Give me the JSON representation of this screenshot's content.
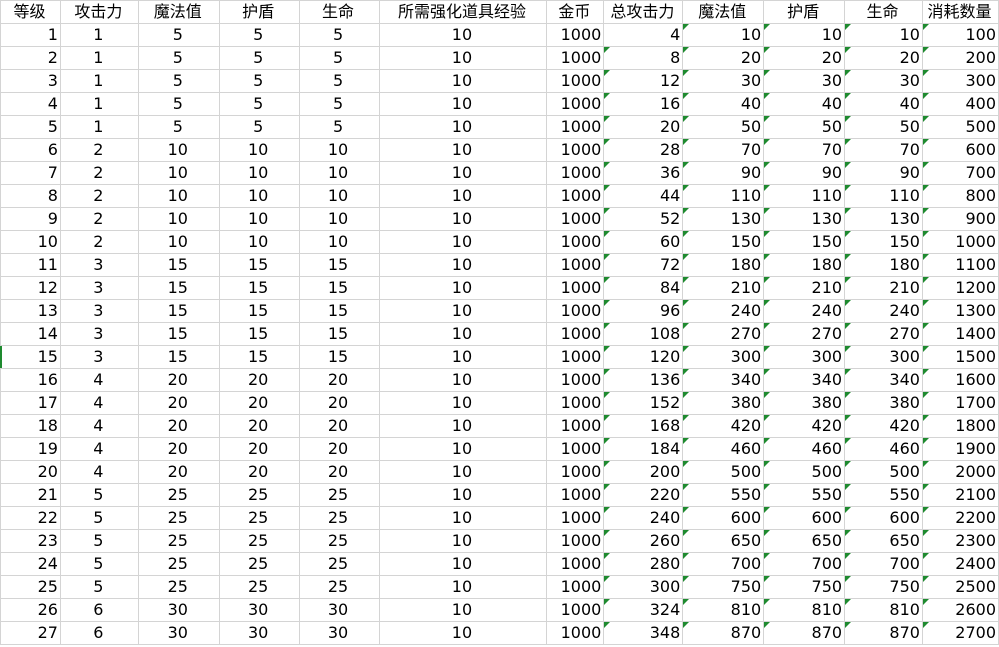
{
  "sheet": {
    "headers": [
      "等级",
      "攻击力",
      "魔法值",
      "护盾",
      "生命",
      "所需强化道具经验",
      "金币",
      "总攻击力",
      "魔法值",
      "护盾",
      "生命",
      "消耗数量"
    ],
    "rows": [
      [
        "1",
        "1",
        "5",
        "5",
        "5",
        "10",
        "1000",
        "4",
        "10",
        "10",
        "10",
        "100"
      ],
      [
        "2",
        "1",
        "5",
        "5",
        "5",
        "10",
        "1000",
        "8",
        "20",
        "20",
        "20",
        "200"
      ],
      [
        "3",
        "1",
        "5",
        "5",
        "5",
        "10",
        "1000",
        "12",
        "30",
        "30",
        "30",
        "300"
      ],
      [
        "4",
        "1",
        "5",
        "5",
        "5",
        "10",
        "1000",
        "16",
        "40",
        "40",
        "40",
        "400"
      ],
      [
        "5",
        "1",
        "5",
        "5",
        "5",
        "10",
        "1000",
        "20",
        "50",
        "50",
        "50",
        "500"
      ],
      [
        "6",
        "2",
        "10",
        "10",
        "10",
        "10",
        "1000",
        "28",
        "70",
        "70",
        "70",
        "600"
      ],
      [
        "7",
        "2",
        "10",
        "10",
        "10",
        "10",
        "1000",
        "36",
        "90",
        "90",
        "90",
        "700"
      ],
      [
        "8",
        "2",
        "10",
        "10",
        "10",
        "10",
        "1000",
        "44",
        "110",
        "110",
        "110",
        "800"
      ],
      [
        "9",
        "2",
        "10",
        "10",
        "10",
        "10",
        "1000",
        "52",
        "130",
        "130",
        "130",
        "900"
      ],
      [
        "10",
        "2",
        "10",
        "10",
        "10",
        "10",
        "1000",
        "60",
        "150",
        "150",
        "150",
        "1000"
      ],
      [
        "11",
        "3",
        "15",
        "15",
        "15",
        "10",
        "1000",
        "72",
        "180",
        "180",
        "180",
        "1100"
      ],
      [
        "12",
        "3",
        "15",
        "15",
        "15",
        "10",
        "1000",
        "84",
        "210",
        "210",
        "210",
        "1200"
      ],
      [
        "13",
        "3",
        "15",
        "15",
        "15",
        "10",
        "1000",
        "96",
        "240",
        "240",
        "240",
        "1300"
      ],
      [
        "14",
        "3",
        "15",
        "15",
        "15",
        "10",
        "1000",
        "108",
        "270",
        "270",
        "270",
        "1400"
      ],
      [
        "15",
        "3",
        "15",
        "15",
        "15",
        "10",
        "1000",
        "120",
        "300",
        "300",
        "300",
        "1500"
      ],
      [
        "16",
        "4",
        "20",
        "20",
        "20",
        "10",
        "1000",
        "136",
        "340",
        "340",
        "340",
        "1600"
      ],
      [
        "17",
        "4",
        "20",
        "20",
        "20",
        "10",
        "1000",
        "152",
        "380",
        "380",
        "380",
        "1700"
      ],
      [
        "18",
        "4",
        "20",
        "20",
        "20",
        "10",
        "1000",
        "168",
        "420",
        "420",
        "420",
        "1800"
      ],
      [
        "19",
        "4",
        "20",
        "20",
        "20",
        "10",
        "1000",
        "184",
        "460",
        "460",
        "460",
        "1900"
      ],
      [
        "20",
        "4",
        "20",
        "20",
        "20",
        "10",
        "1000",
        "200",
        "500",
        "500",
        "500",
        "2000"
      ],
      [
        "21",
        "5",
        "25",
        "25",
        "25",
        "10",
        "1000",
        "220",
        "550",
        "550",
        "550",
        "2100"
      ],
      [
        "22",
        "5",
        "25",
        "25",
        "25",
        "10",
        "1000",
        "240",
        "600",
        "600",
        "600",
        "2200"
      ],
      [
        "23",
        "5",
        "25",
        "25",
        "25",
        "10",
        "1000",
        "260",
        "650",
        "650",
        "650",
        "2300"
      ],
      [
        "24",
        "5",
        "25",
        "25",
        "25",
        "10",
        "1000",
        "280",
        "700",
        "700",
        "700",
        "2400"
      ],
      [
        "25",
        "5",
        "25",
        "25",
        "25",
        "10",
        "1000",
        "300",
        "750",
        "750",
        "750",
        "2500"
      ],
      [
        "26",
        "6",
        "30",
        "30",
        "30",
        "10",
        "1000",
        "324",
        "810",
        "810",
        "810",
        "2600"
      ],
      [
        "27",
        "6",
        "30",
        "30",
        "30",
        "10",
        "1000",
        "348",
        "870",
        "870",
        "870",
        "2700"
      ]
    ],
    "colors": {
      "gridline": "#d4d4d4",
      "error_flag": "#1e8a2f",
      "text": "#000000",
      "background": "#ffffff"
    }
  }
}
